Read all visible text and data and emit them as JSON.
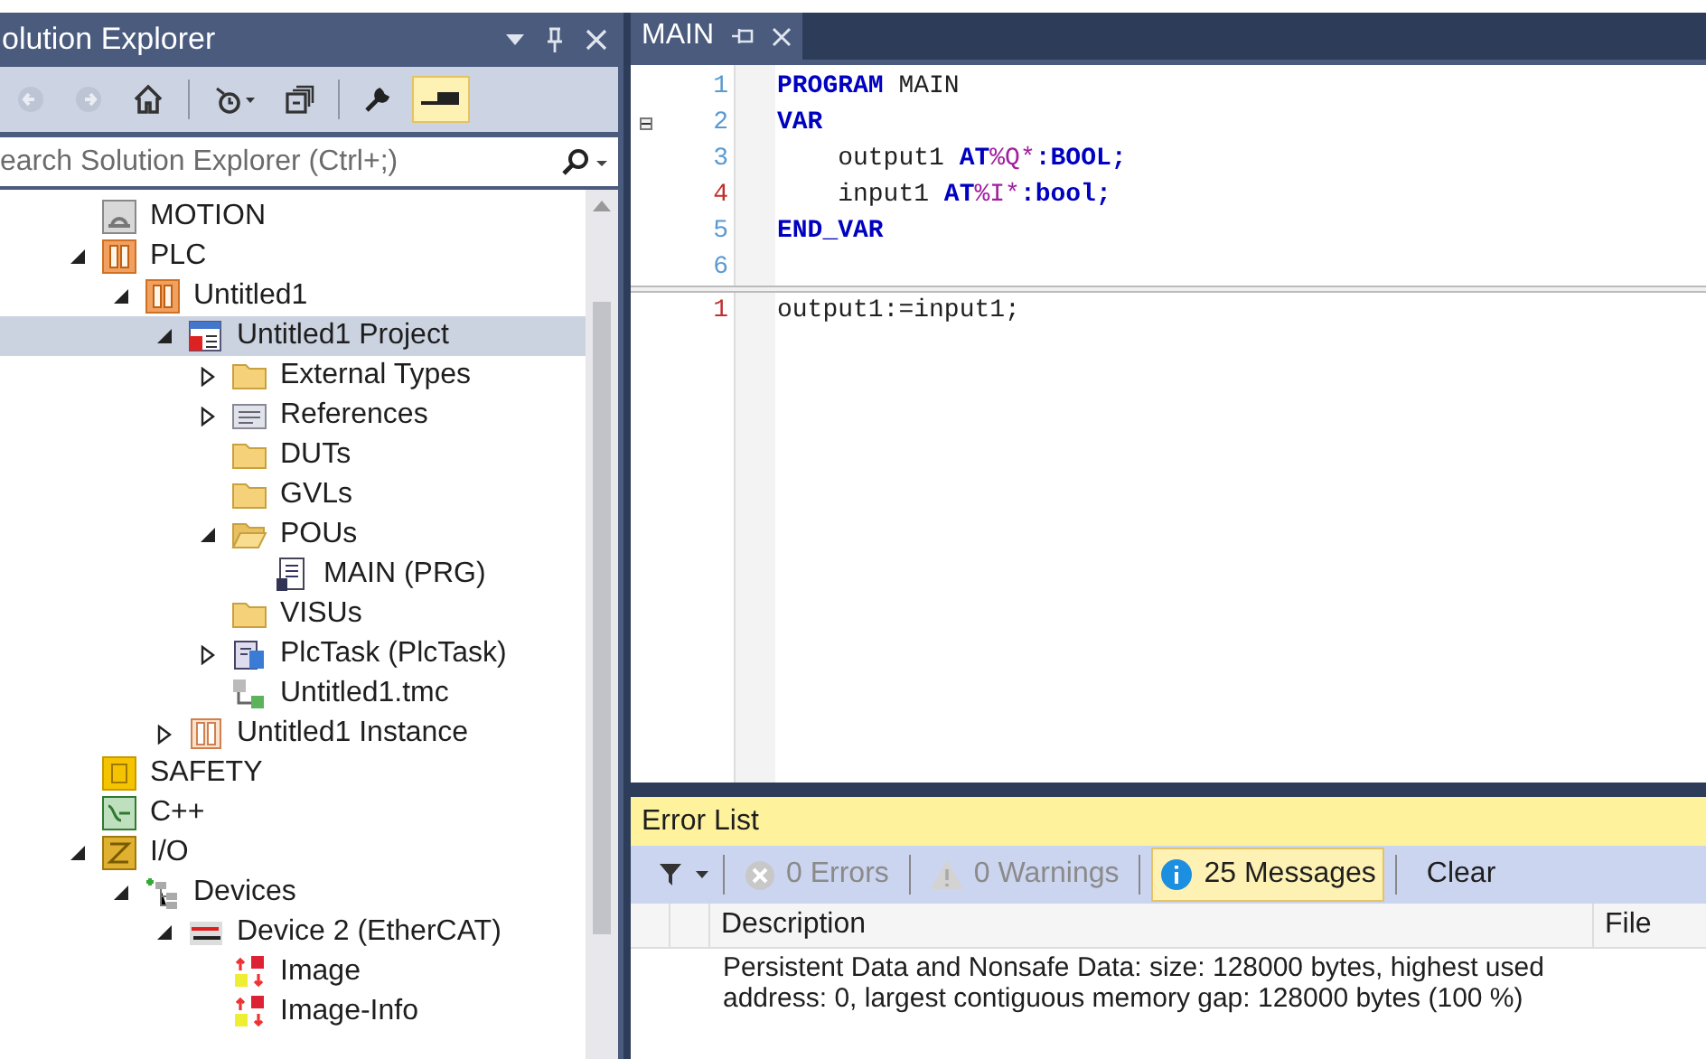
{
  "solution_explorer": {
    "title": "olution Explorer",
    "toolbar": [
      {
        "kind": "back",
        "disabled": true,
        "selected": false
      },
      {
        "kind": "forward",
        "disabled": true,
        "selected": false
      },
      {
        "kind": "home",
        "disabled": false,
        "selected": false
      },
      {
        "kind": "sync",
        "disabled": false,
        "selected": false
      },
      {
        "kind": "collapse",
        "disabled": false,
        "selected": false
      },
      {
        "kind": "properties",
        "disabled": false,
        "selected": false
      },
      {
        "kind": "preview",
        "disabled": false,
        "selected": true
      }
    ],
    "search": {
      "placeholder": "earch Solution Explorer (Ctrl+;)"
    },
    "tree": [
      {
        "label": "MOTION",
        "kind": "motion",
        "selected": false
      },
      {
        "label": "PLC",
        "kind": "plc",
        "selected": false,
        "expanded": true,
        "children": [
          {
            "label": "Untitled1",
            "kind": "plc",
            "selected": false,
            "expanded": true,
            "children": [
              {
                "label": "Untitled1 Project",
                "kind": "project",
                "selected": true,
                "expanded": true,
                "children": [
                  {
                    "label": "External Types",
                    "kind": "folder",
                    "selected": false,
                    "expanded": false
                  },
                  {
                    "label": "References",
                    "kind": "references",
                    "selected": false,
                    "expanded": false
                  },
                  {
                    "label": "DUTs",
                    "kind": "folder",
                    "selected": false
                  },
                  {
                    "label": "GVLs",
                    "kind": "folder",
                    "selected": false
                  },
                  {
                    "label": "POUs",
                    "kind": "folder-open",
                    "selected": false,
                    "expanded": true,
                    "children": [
                      {
                        "label": "MAIN (PRG)",
                        "kind": "pou",
                        "selected": false
                      }
                    ]
                  },
                  {
                    "label": "VISUs",
                    "kind": "folder",
                    "selected": false
                  },
                  {
                    "label": "PlcTask (PlcTask)",
                    "kind": "task",
                    "selected": false,
                    "expanded": false
                  },
                  {
                    "label": "Untitled1.tmc",
                    "kind": "tmc",
                    "selected": false
                  }
                ]
              },
              {
                "label": "Untitled1 Instance",
                "kind": "instance",
                "selected": false,
                "expanded": false
              }
            ]
          }
        ]
      },
      {
        "label": "SAFETY",
        "kind": "safety",
        "selected": false
      },
      {
        "label": "C++",
        "kind": "cpp",
        "selected": false
      },
      {
        "label": "I/O",
        "kind": "io",
        "selected": false,
        "expanded": true,
        "children": [
          {
            "label": "Devices",
            "kind": "devices",
            "selected": false,
            "expanded": true,
            "children": [
              {
                "label": "Device 2 (EtherCAT)",
                "kind": "ethercat",
                "selected": false,
                "expanded": true,
                "children": [
                  {
                    "label": "Image",
                    "kind": "image",
                    "selected": false
                  },
                  {
                    "label": "Image-Info",
                    "kind": "image",
                    "selected": false
                  }
                ]
              }
            ]
          }
        ]
      }
    ]
  },
  "editor": {
    "tab": {
      "label": "MAIN",
      "selected": true
    },
    "declaration": [
      {
        "number": "1",
        "changed": false,
        "fold": false,
        "tokens": [
          {
            "kind": "keyword",
            "text": "PROGRAM"
          },
          {
            "kind": "plain",
            "text": " MAIN"
          }
        ]
      },
      {
        "number": "2",
        "changed": false,
        "fold": true,
        "tokens": [
          {
            "kind": "keyword",
            "text": "VAR"
          }
        ]
      },
      {
        "number": "3",
        "changed": false,
        "fold": false,
        "tokens": [
          {
            "kind": "plain",
            "text": "    output1 "
          },
          {
            "kind": "keyword",
            "text": "AT"
          },
          {
            "kind": "address",
            "text": "%Q*"
          },
          {
            "kind": "keyword",
            "text": ":BOOL;"
          }
        ]
      },
      {
        "number": "4",
        "changed": true,
        "fold": false,
        "tokens": [
          {
            "kind": "plain",
            "text": "    input1 "
          },
          {
            "kind": "keyword",
            "text": "AT"
          },
          {
            "kind": "address",
            "text": "%I*"
          },
          {
            "kind": "keyword",
            "text": ":bool;"
          }
        ]
      },
      {
        "number": "5",
        "changed": false,
        "fold": false,
        "tokens": [
          {
            "kind": "keyword",
            "text": "END_VAR"
          }
        ]
      },
      {
        "number": "6",
        "changed": false,
        "fold": false
      }
    ],
    "body": [
      {
        "number": "1",
        "changed": true,
        "fold": false,
        "tokens": [
          {
            "kind": "plain",
            "text": "output1:=input1;"
          }
        ]
      }
    ]
  },
  "error_list": {
    "title": "Error List",
    "filters": [
      {
        "kind": "errors",
        "label": "0 Errors",
        "selected": false,
        "disabled": true
      },
      {
        "kind": "warnings",
        "label": "0 Warnings",
        "selected": false,
        "disabled": true
      },
      {
        "kind": "messages",
        "label": "25 Messages",
        "selected": true,
        "disabled": false
      }
    ],
    "clear": "Clear",
    "columns": [
      "Description",
      "File"
    ],
    "rows": [
      {
        "description": "Persistent Data and Nonsafe Data: size: 128000 bytes, highest used address: 0, largest contiguous memory gap: 128000 bytes (100 %)"
      }
    ]
  }
}
